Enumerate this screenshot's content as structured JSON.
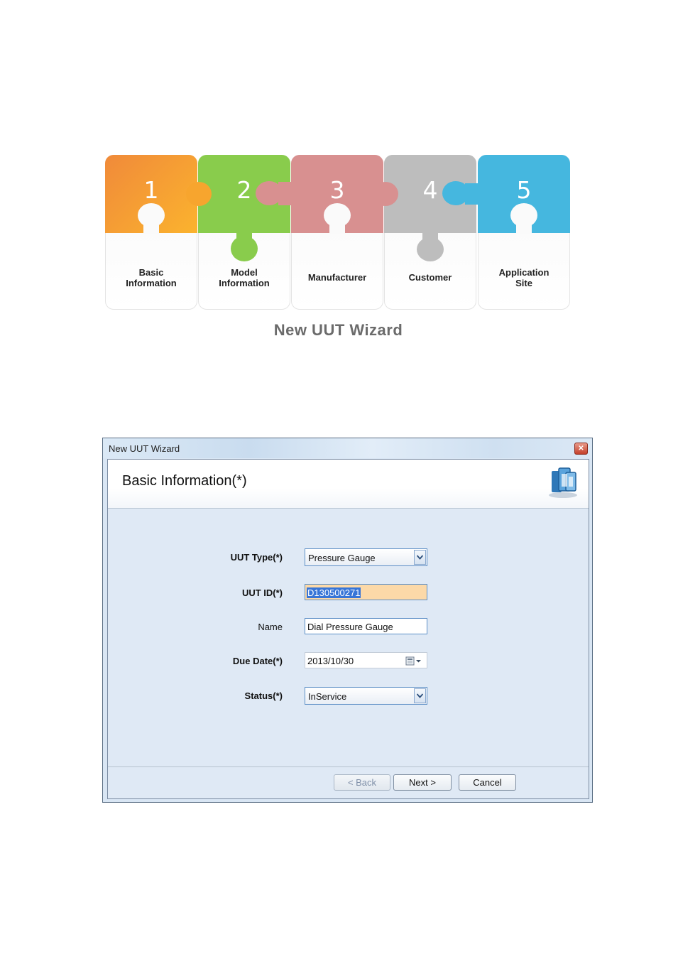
{
  "wizard_steps": [
    {
      "number": "1",
      "label_line1": "Basic",
      "label_line2": "Information"
    },
    {
      "number": "2",
      "label_line1": "Model",
      "label_line2": "Information"
    },
    {
      "number": "3",
      "label_line1": "Manufacturer",
      "label_line2": ""
    },
    {
      "number": "4",
      "label_line1": "Customer",
      "label_line2": ""
    },
    {
      "number": "5",
      "label_line1": "Application",
      "label_line2": "Site"
    }
  ],
  "wizard_caption": "New UUT Wizard",
  "step_colors": [
    "#f59a35",
    "#89cc4c",
    "#d89090",
    "#bdbdbd",
    "#45b7df"
  ],
  "dialog": {
    "title": "New UUT Wizard",
    "close_icon": "close-icon",
    "header_title": "Basic Information(*)",
    "fields": {
      "uut_type": {
        "label": "UUT Type(*)",
        "value": "Pressure Gauge"
      },
      "uut_id": {
        "label": "UUT ID(*)",
        "value": "D130500271"
      },
      "name": {
        "label": "Name",
        "value": "Dial Pressure Gauge"
      },
      "due_date": {
        "label": "Due Date(*)",
        "value": "2013/10/30"
      },
      "status": {
        "label": "Status(*)",
        "value": "InService"
      }
    },
    "buttons": {
      "back": "< Back",
      "next": "Next >",
      "cancel": "Cancel"
    }
  }
}
